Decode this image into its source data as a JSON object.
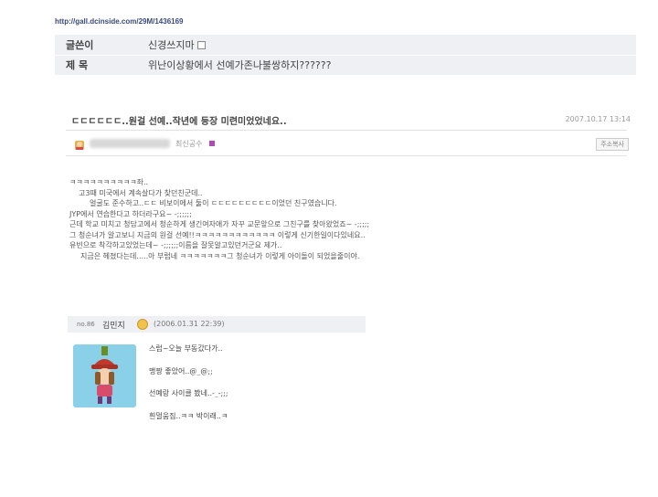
{
  "url": "http://gall.dcinside.com/29M/1436169",
  "info": {
    "writer_label": "글쓴이",
    "writer_value": "신경쓰지마",
    "title_label": "제 목",
    "title_value": "위난이상황에서 선예가존나불쌍하지??????"
  },
  "post": {
    "title": "ㄷㄷㄷㄷㄷㄷ..원걸 선예..작년에 등장 미련미었었네요..",
    "date": "2007.10.17 13:14",
    "author_level": "최신공수",
    "reply_label": "주소복사",
    "body_lines": [
      "ㅋㅋㅋㅋㅋㅋㅋㅋㅋㅋ좌..",
      "고3때 미국에서 계속살다가 찾던친군데..",
      "얼굴도 준수하고..ㄷㄷ 비보이에서 둘이 ㄷㄷㄷㄷㄷㄷㄷㄷㄷ이었던 친구였습니다.",
      "JYP에서 연습한다고 하더라구요~ -;;;;;;",
      "근데 학교 미치고 청담고에서 청순하게 생긴여자애가 자꾸 교문앞으로 그친구를 찾아왔었죠~ -;;;;;",
      "그 청순녀가 알고보니 지금의 원걸 선예!!ㅋㅋㅋㅋㅋㅋㅋㅋㅋㅋㅋㅋ 이렇게 신기한일이다있네요..",
      "유빈으로 착각하고있었는데~ -;;;;;;이름을 잘못알고있던거군요 제가..",
      "지금은 헤졌다는데.....아 부럽네 ㅋㅋㅋㅋㅋㅋㅋ그 청순녀가 이렇게 아이돌이 되었을줄이야."
    ]
  },
  "comment": {
    "number": "no.86",
    "name": "김민지",
    "date": "(2006.01.31 22:39)",
    "lines": [
      "스럽~오늘 부동갔다가..",
      "맹짱 좋았어..@_@;;",
      "선예랑 사이클 봤네..-_-;;;",
      "흰멀움짐..ㅋㅋ 박이래..ㅋ"
    ]
  },
  "colors": {
    "info_bg": "#eef0f3",
    "url": "#3a4a7a",
    "avatar_bg": "#8ad0e8",
    "badge": "#b04ab8"
  }
}
